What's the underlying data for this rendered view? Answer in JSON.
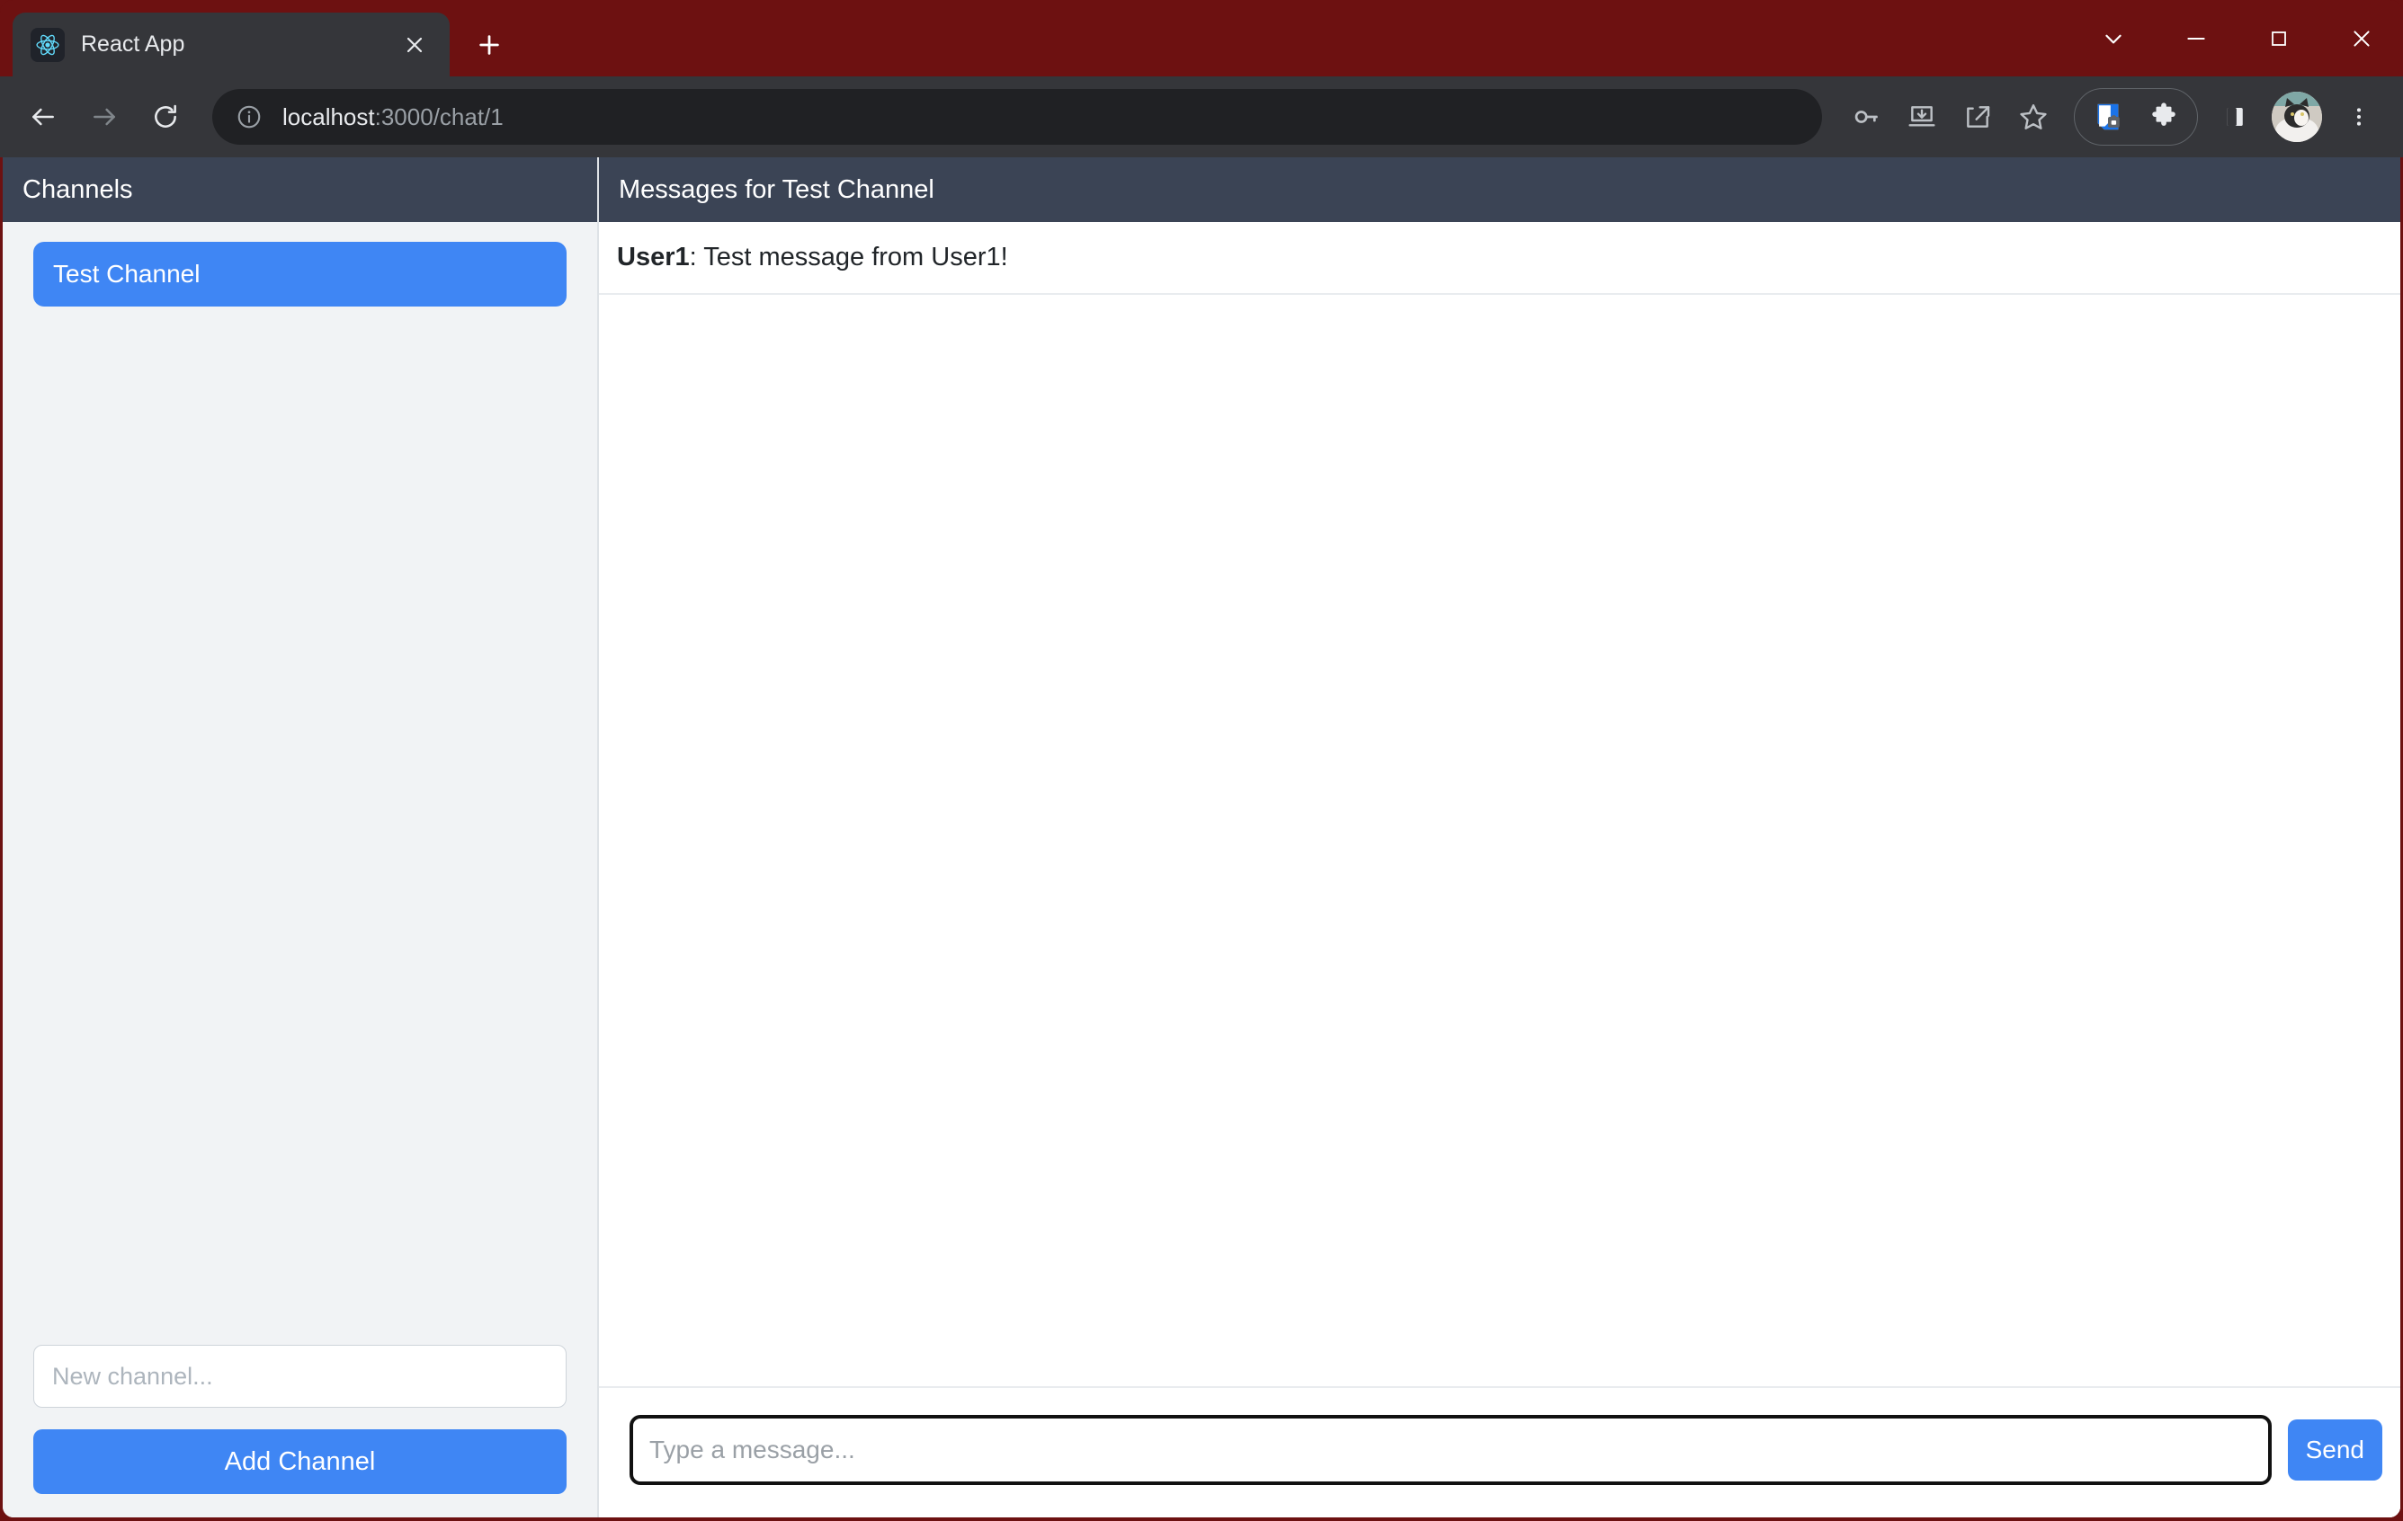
{
  "browser": {
    "theme_color": "#6d1111",
    "tab": {
      "title": "React App",
      "favicon": "react-logo-icon",
      "close_icon": "close-icon"
    },
    "new_tab_icon": "plus-icon",
    "window_controls": {
      "tab_search_icon": "chevron-down-icon",
      "minimize_icon": "minimize-icon",
      "maximize_icon": "maximize-icon",
      "close_icon": "close-icon"
    },
    "nav": {
      "back_icon": "back-arrow-icon",
      "forward_icon": "forward-arrow-icon",
      "reload_icon": "reload-icon"
    },
    "omnibox": {
      "site_info_icon": "info-circle-icon",
      "url_host": "localhost",
      "url_rest": ":3000/chat/1",
      "full_url": "localhost:3000/chat/1"
    },
    "toolbar_icons": [
      "password-key-icon",
      "install-download-icon",
      "share-icon",
      "bookmark-star-icon",
      "password-manager-extension-icon",
      "extensions-puzzle-icon",
      "side-panel-icon",
      "profile-avatar",
      "more-menu-icon"
    ]
  },
  "app": {
    "sidebar": {
      "header": "Channels",
      "channels": [
        {
          "name": "Test Channel",
          "active": true
        }
      ],
      "new_channel_placeholder": "New channel...",
      "new_channel_value": "",
      "add_channel_label": "Add Channel"
    },
    "chat": {
      "header": "Messages for Test Channel",
      "messages": [
        {
          "author": "User1",
          "separator": ": ",
          "text": "Test message from User1!"
        }
      ],
      "input_placeholder": "Type a message...",
      "input_value": "",
      "send_label": "Send"
    },
    "colors": {
      "header_bg": "#3b4455",
      "accent_blue": "#3f86f4",
      "sidebar_bg": "#f1f3f5"
    }
  }
}
